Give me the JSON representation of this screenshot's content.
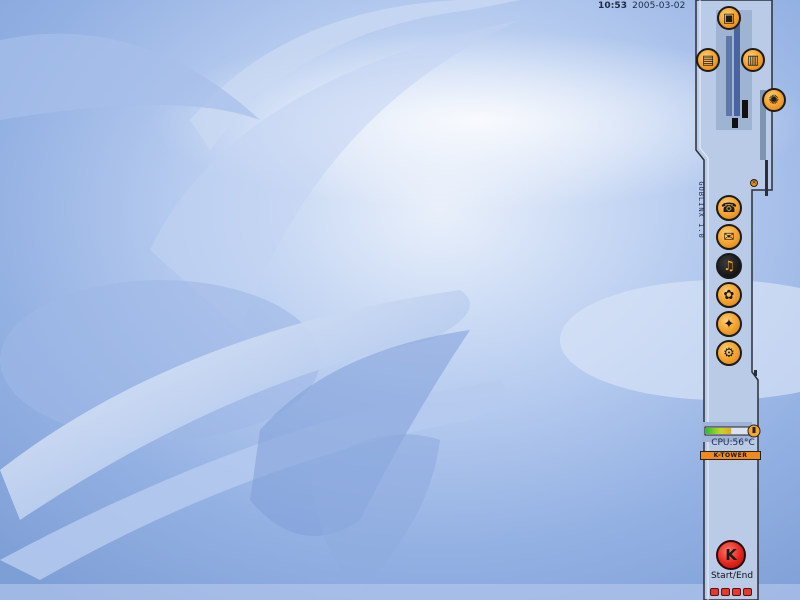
{
  "taskbar": {
    "clock_time": "10:53",
    "clock_date": "2005-03-02"
  },
  "tower": {
    "brand_vertical": "GOBLINX 1.0",
    "cpu_label": "CPU:56°C",
    "cpu_level": 0.6,
    "name_label": "K-TOWER",
    "start_label": "Start/End",
    "top_icons": [
      {
        "name": "tools-icon",
        "glyph": "▣"
      },
      {
        "name": "cards-icon",
        "glyph": "▤"
      },
      {
        "name": "calendar-icon",
        "glyph": "▥"
      },
      {
        "name": "firefox-icon",
        "glyph": "✺"
      }
    ],
    "launcher_icons": [
      {
        "name": "network-icon",
        "glyph": "☎"
      },
      {
        "name": "mail-icon",
        "glyph": "✉"
      },
      {
        "name": "media-icon",
        "glyph": "♫"
      },
      {
        "name": "flower-icon",
        "glyph": "✿"
      },
      {
        "name": "runner-icon",
        "glyph": "✦"
      },
      {
        "name": "tank-icon",
        "glyph": "⚙"
      }
    ],
    "start_glyph": "K",
    "colors": {
      "accent": "#f7a632",
      "start": "#e3241d",
      "panel": "#b9cbe6"
    }
  }
}
